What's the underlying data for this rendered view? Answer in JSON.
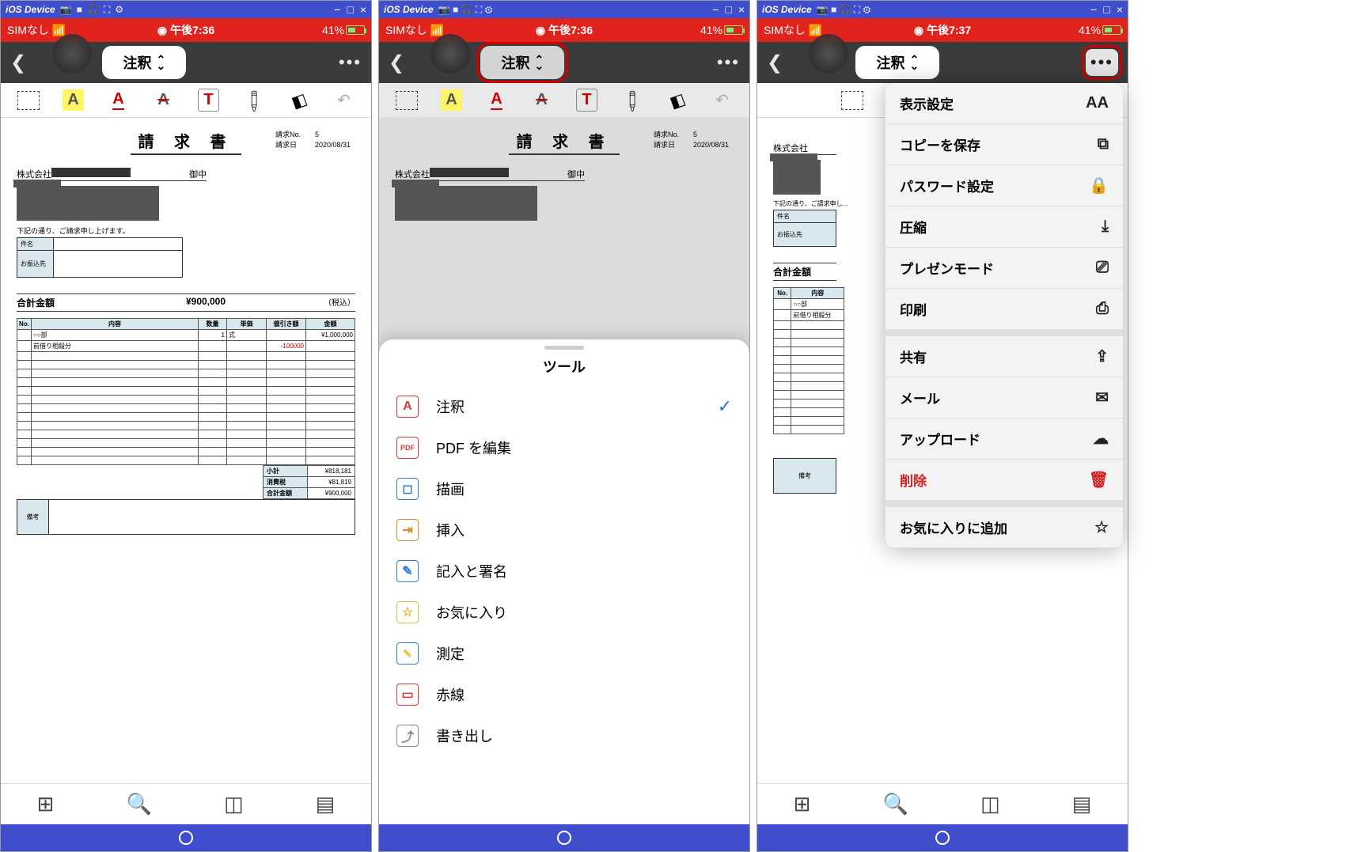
{
  "window": {
    "title": "iOS Device",
    "min": "−",
    "max": "□",
    "close": "×"
  },
  "status": {
    "sim": "SIMなし",
    "time": "午後7:36",
    "time3": "午後7:37",
    "battery": "41%"
  },
  "nav": {
    "mode": "注釈",
    "more": "•••"
  },
  "toolbar_icons": {
    "select": "",
    "highlight": "A",
    "underline": "A",
    "strike": "A",
    "text": "T",
    "pen": "✎",
    "eraser": "◧",
    "undo": "↶"
  },
  "invoice": {
    "title": "請 求 書",
    "no_label": "請求No.",
    "no": "5",
    "date_label": "請求日",
    "date": "2020/08/31",
    "client_prefix": "株式会社",
    "client_suffix": "御中",
    "lead": "下記の通り、ご請求申し上げます。",
    "box": {
      "subject_label": "件名",
      "bank_label": "お振込先"
    },
    "total_label": "合計金額",
    "total_amount": "¥900,000",
    "tax_incl": "（税込）",
    "cols": {
      "no": "No.",
      "desc": "内容",
      "qty": "数量",
      "unit": "単価",
      "disc": "値引き額",
      "amount": "金額"
    },
    "rows": [
      {
        "desc": "○○部",
        "qty": "1",
        "unit": "式",
        "disc": "",
        "amount": "¥1,000,000"
      },
      {
        "desc": "前借り相殺分",
        "qty": "",
        "unit": "",
        "disc": "-100000",
        "amount": ""
      }
    ],
    "subtotal_label": "小計",
    "subtotal": "¥818,181",
    "tax_label": "消費税",
    "tax": "¥81,819",
    "grand_label": "合計金額",
    "grand": "¥900,000",
    "remarks_label": "備考"
  },
  "bottom_icons": {
    "grid": "▦",
    "search": "🔍",
    "book": "▯▯",
    "page": "▤"
  },
  "tools_sheet": {
    "title": "ツール",
    "items": [
      {
        "icon": "A",
        "color": "#d63a3a",
        "label": "注釈",
        "checked": true
      },
      {
        "icon": "PDF",
        "color": "#d63a3a",
        "label": "PDF を編集"
      },
      {
        "icon": "◻",
        "color": "#2b7de0",
        "label": "描画"
      },
      {
        "icon": "⇥",
        "color": "#e28a2a",
        "label": "挿入"
      },
      {
        "icon": "✎",
        "color": "#2b7de0",
        "label": "記入と署名"
      },
      {
        "icon": "☆",
        "color": "#e6b93a",
        "label": "お気に入り"
      },
      {
        "icon": "📏",
        "color": "#2b7de0",
        "label": "測定"
      },
      {
        "icon": "▭",
        "color": "#d63a3a",
        "label": "赤線"
      },
      {
        "icon": "⤴",
        "color": "#888",
        "label": "書き出し"
      }
    ]
  },
  "more_menu": {
    "items": [
      {
        "label": "表示設定",
        "icon": "AA"
      },
      {
        "label": "コピーを保存",
        "icon": "⧉"
      },
      {
        "label": "パスワード設定",
        "icon": "🔒"
      },
      {
        "label": "圧縮",
        "icon": "⤓"
      },
      {
        "label": "プレゼンモード",
        "icon": "⎚"
      },
      {
        "label": "印刷",
        "icon": "⎙"
      }
    ],
    "items2": [
      {
        "label": "共有",
        "icon": "⇪"
      },
      {
        "label": "メール",
        "icon": "✉"
      },
      {
        "label": "アップロード",
        "icon": "☁︎"
      },
      {
        "label": "削除",
        "icon": "🗑",
        "danger": true
      }
    ],
    "items3": [
      {
        "label": "お気に入りに追加",
        "icon": "☆"
      }
    ]
  }
}
